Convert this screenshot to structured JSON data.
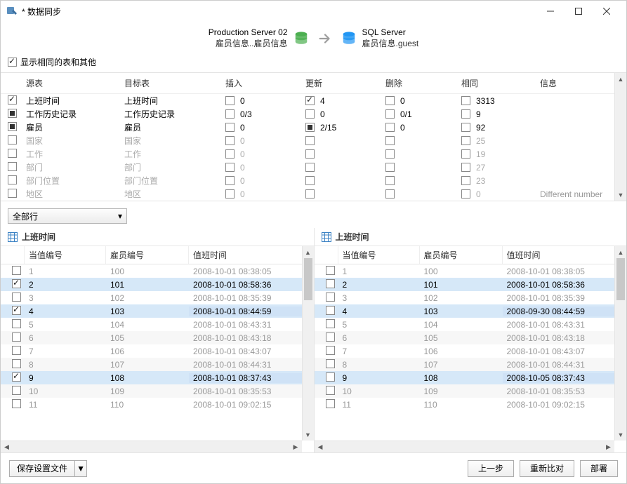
{
  "window": {
    "title": "* 数据同步"
  },
  "servers": {
    "source": {
      "name": "Production Server 02",
      "path": "雇员信息..雇员信息"
    },
    "target": {
      "name": "SQL Server",
      "path": "雇员信息.guest"
    }
  },
  "options": {
    "show_identical_label": "显示相同的表和其他",
    "show_identical_checked": true
  },
  "tables_header": {
    "source": "源表",
    "target": "目标表",
    "insert": "插入",
    "update": "更新",
    "delete": "删除",
    "same": "相同",
    "info": "信息"
  },
  "tables": [
    {
      "checked": "checked",
      "src": "上班时间",
      "tgt": "上班时间",
      "ins_cb": false,
      "ins": "0",
      "upd_cb": "checked",
      "upd": "4",
      "del_cb": false,
      "del": "0",
      "same_cb": false,
      "same": "3313",
      "info": "",
      "enabled": true
    },
    {
      "checked": "indet",
      "src": "工作历史记录",
      "tgt": "工作历史记录",
      "ins_cb": false,
      "ins": "0/3",
      "upd_cb": false,
      "upd": "0",
      "del_cb": false,
      "del": "0/1",
      "same_cb": false,
      "same": "9",
      "info": "",
      "enabled": true
    },
    {
      "checked": "indet",
      "src": "雇员",
      "tgt": "雇员",
      "ins_cb": false,
      "ins": "0",
      "upd_cb": "indet",
      "upd": "2/15",
      "del_cb": false,
      "del": "0",
      "same_cb": false,
      "same": "92",
      "info": "",
      "enabled": true
    },
    {
      "checked": false,
      "src": "国家",
      "tgt": "国家",
      "ins_cb": false,
      "ins": "0",
      "upd_cb": false,
      "upd": "",
      "del_cb": false,
      "del": "",
      "same_cb": false,
      "same": "25",
      "info": "",
      "enabled": false
    },
    {
      "checked": false,
      "src": "工作",
      "tgt": "工作",
      "ins_cb": false,
      "ins": "0",
      "upd_cb": false,
      "upd": "",
      "del_cb": false,
      "del": "",
      "same_cb": false,
      "same": "19",
      "info": "",
      "enabled": false
    },
    {
      "checked": false,
      "src": "部门",
      "tgt": "部门",
      "ins_cb": false,
      "ins": "0",
      "upd_cb": false,
      "upd": "",
      "del_cb": false,
      "del": "",
      "same_cb": false,
      "same": "27",
      "info": "",
      "enabled": false
    },
    {
      "checked": false,
      "src": "部门位置",
      "tgt": "部门位置",
      "ins_cb": false,
      "ins": "0",
      "upd_cb": false,
      "upd": "",
      "del_cb": false,
      "del": "",
      "same_cb": false,
      "same": "23",
      "info": "",
      "enabled": false
    },
    {
      "checked": false,
      "src": "地区",
      "tgt": "地区",
      "ins_cb": false,
      "ins": "0",
      "upd_cb": false,
      "upd": "",
      "del_cb": false,
      "del": "",
      "same_cb": false,
      "same": "0",
      "info": "Different number",
      "enabled": false
    }
  ],
  "filter": {
    "label": "全部行"
  },
  "data_panels": {
    "left": {
      "title": "上班时间",
      "columns": {
        "a": "当值编号",
        "b": "雇员编号",
        "c": "值班时间"
      },
      "rows": [
        {
          "cb": false,
          "a": "1",
          "b": "100",
          "c": "2008-10-01 08:38:05",
          "style": "gray"
        },
        {
          "cb": "checked",
          "a": "2",
          "b": "101",
          "c": "2008-10-01 08:58:36",
          "style": "sel"
        },
        {
          "cb": false,
          "a": "3",
          "b": "102",
          "c": "2008-10-01 08:35:39",
          "style": "gray"
        },
        {
          "cb": "checked",
          "a": "4",
          "b": "103",
          "c": "2008-10-01 08:44:59",
          "style": "sel",
          "c_changed": true
        },
        {
          "cb": false,
          "a": "5",
          "b": "104",
          "c": "2008-10-01 08:43:31",
          "style": "gray"
        },
        {
          "cb": false,
          "a": "6",
          "b": "105",
          "c": "2008-10-01 08:43:18",
          "style": "gray alt"
        },
        {
          "cb": false,
          "a": "7",
          "b": "106",
          "c": "2008-10-01 08:43:07",
          "style": "gray"
        },
        {
          "cb": false,
          "a": "8",
          "b": "107",
          "c": "2008-10-01 08:44:31",
          "style": "gray alt"
        },
        {
          "cb": "checked",
          "a": "9",
          "b": "108",
          "c": "2008-10-01 08:37:43",
          "style": "sel",
          "c_changed": true
        },
        {
          "cb": false,
          "a": "10",
          "b": "109",
          "c": "2008-10-01 08:35:53",
          "style": "gray alt"
        },
        {
          "cb": false,
          "a": "11",
          "b": "110",
          "c": "2008-10-01 09:02:15",
          "style": "gray"
        }
      ]
    },
    "right": {
      "title": "上班时间",
      "columns": {
        "a": "当值编号",
        "b": "雇员编号",
        "c": "值班时间"
      },
      "rows": [
        {
          "cb": false,
          "a": "1",
          "b": "100",
          "c": "2008-10-01 08:38:05",
          "style": "gray"
        },
        {
          "cb": false,
          "a": "2",
          "b": "101",
          "c": "2008-10-01 08:58:36",
          "style": "sel"
        },
        {
          "cb": false,
          "a": "3",
          "b": "102",
          "c": "2008-10-01 08:35:39",
          "style": "gray"
        },
        {
          "cb": false,
          "a": "4",
          "b": "103",
          "c": "2008-09-30 08:44:59",
          "style": "sel",
          "c_changed": true
        },
        {
          "cb": false,
          "a": "5",
          "b": "104",
          "c": "2008-10-01 08:43:31",
          "style": "gray"
        },
        {
          "cb": false,
          "a": "6",
          "b": "105",
          "c": "2008-10-01 08:43:18",
          "style": "gray alt"
        },
        {
          "cb": false,
          "a": "7",
          "b": "106",
          "c": "2008-10-01 08:43:07",
          "style": "gray"
        },
        {
          "cb": false,
          "a": "8",
          "b": "107",
          "c": "2008-10-01 08:44:31",
          "style": "gray alt"
        },
        {
          "cb": false,
          "a": "9",
          "b": "108",
          "c": "2008-10-05 08:37:43",
          "style": "sel",
          "c_changed": true
        },
        {
          "cb": false,
          "a": "10",
          "b": "109",
          "c": "2008-10-01 08:35:53",
          "style": "gray alt"
        },
        {
          "cb": false,
          "a": "11",
          "b": "110",
          "c": "2008-10-01 09:02:15",
          "style": "gray"
        }
      ]
    }
  },
  "footer": {
    "save_profile": "保存设置文件",
    "back": "上一步",
    "recompare": "重新比对",
    "deploy": "部署"
  }
}
